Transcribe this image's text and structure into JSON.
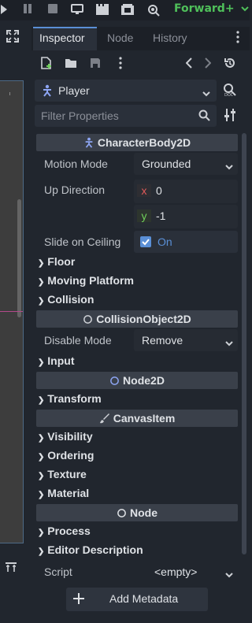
{
  "toolbar": {
    "icons": [
      "play-icon",
      "pause-icon",
      "stop-icon",
      "remote-debug-icon",
      "movie-icon",
      "scene-icon",
      "search-scene-icon"
    ],
    "renderer_label": "Forward+",
    "renderer_color": "#4fc05a"
  },
  "dock": {
    "tabs": [
      "Inspector",
      "Node",
      "History"
    ]
  },
  "inspector": {
    "object_name": "Player",
    "filter_placeholder": "Filter Properties",
    "categories": {
      "characterbody": "CharacterBody2D",
      "collisionobject": "CollisionObject2D",
      "node2d": "Node2D",
      "canvasitem": "CanvasItem",
      "node": "Node"
    },
    "props": {
      "motion_mode_label": "Motion Mode",
      "motion_mode_value": "Grounded",
      "up_direction_label": "Up Direction",
      "up_x_label": "x",
      "up_x_value": "0",
      "up_y_label": "y",
      "up_y_value": "-1",
      "slide_label": "Slide on Ceiling",
      "slide_value": "On",
      "disable_mode_label": "Disable Mode",
      "disable_mode_value": "Remove",
      "script_label": "Script",
      "script_value": "<empty>"
    },
    "sections": {
      "floor": "Floor",
      "moving_platform": "Moving Platform",
      "collision": "Collision",
      "input": "Input",
      "transform": "Transform",
      "visibility": "Visibility",
      "ordering": "Ordering",
      "texture": "Texture",
      "material": "Material",
      "process": "Process",
      "editor_description": "Editor Description"
    },
    "add_metadata": "Add Metadata"
  },
  "colors": {
    "accent": "#5a8fd6",
    "x_axis": "#e05a5a",
    "y_axis": "#6fcf5a",
    "checkbox": "#5a8fd6"
  }
}
